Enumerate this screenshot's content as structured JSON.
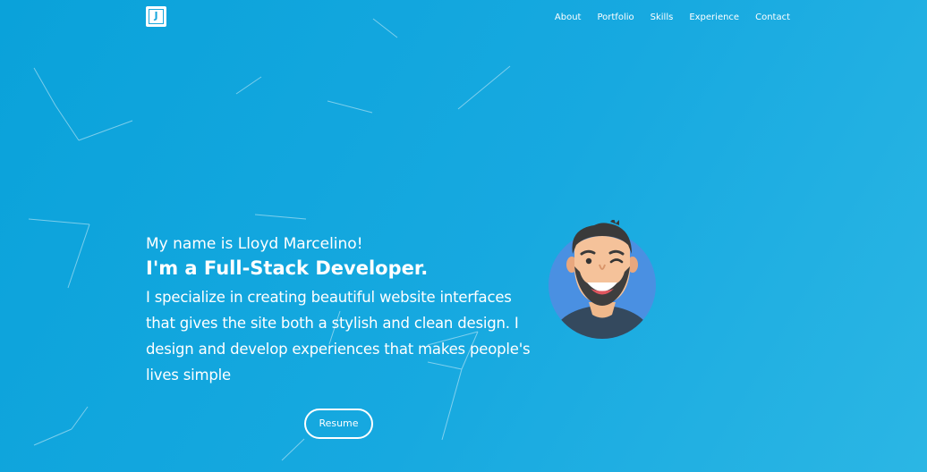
{
  "logo": {
    "letter": "J"
  },
  "nav": {
    "items": [
      {
        "label": "About"
      },
      {
        "label": "Portfolio"
      },
      {
        "label": "Skills"
      },
      {
        "label": "Experience"
      },
      {
        "label": "Contact"
      }
    ]
  },
  "hero": {
    "greeting": "My name is Lloyd Marcelino!",
    "role": "I'm a Full-Stack Developer.",
    "bio": "I specialize in creating beautiful website interfaces that gives the site both a stylish and clean design. I design and develop experiences that makes people's lives simple",
    "resume_label": "Resume"
  },
  "colors": {
    "accent": "#1aa7dd",
    "avatar_circle": "#4a90e2",
    "shirt": "#34495e"
  }
}
